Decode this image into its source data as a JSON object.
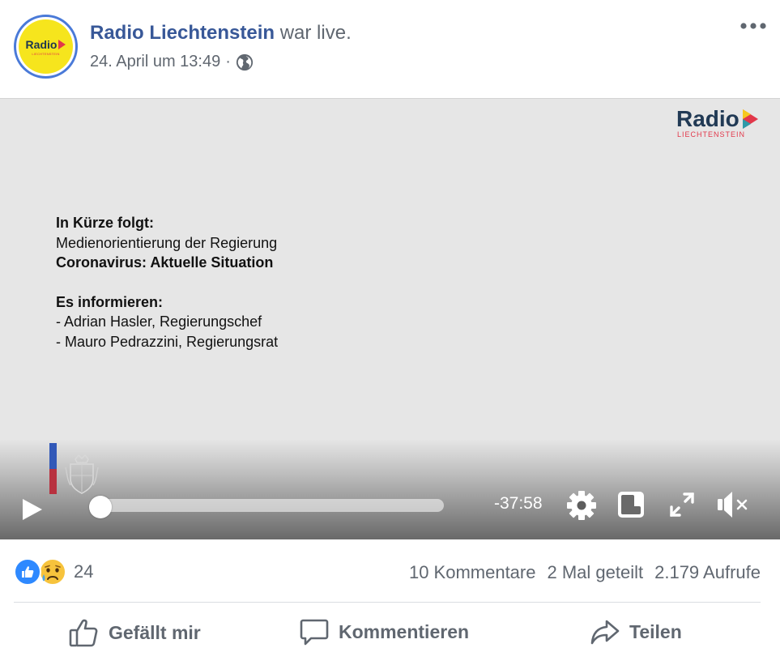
{
  "post": {
    "page_name": "Radio Liechtenstein",
    "action_text": "war live.",
    "timestamp": "24. April um 13:49",
    "separator": "·",
    "privacy_icon": "globe-icon",
    "more_icon": "more-dots-icon",
    "avatar": {
      "word": "Radio",
      "sub": "LIECHTENSTEIN",
      "bg_color": "#f6e51d",
      "ring_color": "#4a7ad8"
    }
  },
  "video": {
    "brand_word": "Radio",
    "brand_sub": "LIECHTENSTEIN",
    "brand_color": "#213a55",
    "accent_color": "#e2374a",
    "slide": {
      "line1": "In Kürze folgt:",
      "line2": "Medienorientierung der Regierung",
      "line3": "Coronavirus: Aktuelle Situation",
      "line4": "Es informieren:",
      "line5": "- Adrian Hasler, Regierungschef",
      "line6": "- Mauro Pedrazzini, Regierungsrat"
    },
    "controls": {
      "play_icon": "play-icon",
      "progress": 0,
      "time_remaining": "-37:58",
      "settings_icon": "gear-icon",
      "pip_icon": "picture-in-picture-icon",
      "fullscreen_icon": "fullscreen-icon",
      "mute_icon": "speaker-muted-icon"
    }
  },
  "stats": {
    "reaction_icons": [
      "like-reaction-icon",
      "sad-reaction-icon"
    ],
    "reaction_count": "24",
    "comments": "10 Kommentare",
    "shares": "2 Mal geteilt",
    "views": "2.179 Aufrufe"
  },
  "actions": {
    "like": "Gefällt mir",
    "comment": "Kommentieren",
    "share": "Teilen"
  }
}
